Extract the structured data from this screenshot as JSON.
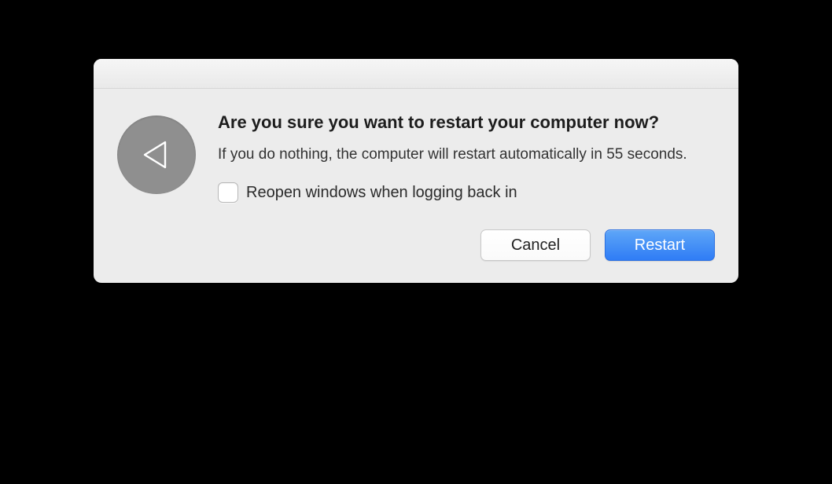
{
  "dialog": {
    "title": "Are you sure you want to restart your computer now?",
    "message": "If you do nothing, the computer will restart automatically in 55 seconds.",
    "countdown_seconds": 55,
    "checkbox": {
      "label": "Reopen windows when logging back in",
      "checked": false
    },
    "buttons": {
      "cancel": "Cancel",
      "confirm": "Restart"
    },
    "icon": "restart-triangle-icon"
  }
}
